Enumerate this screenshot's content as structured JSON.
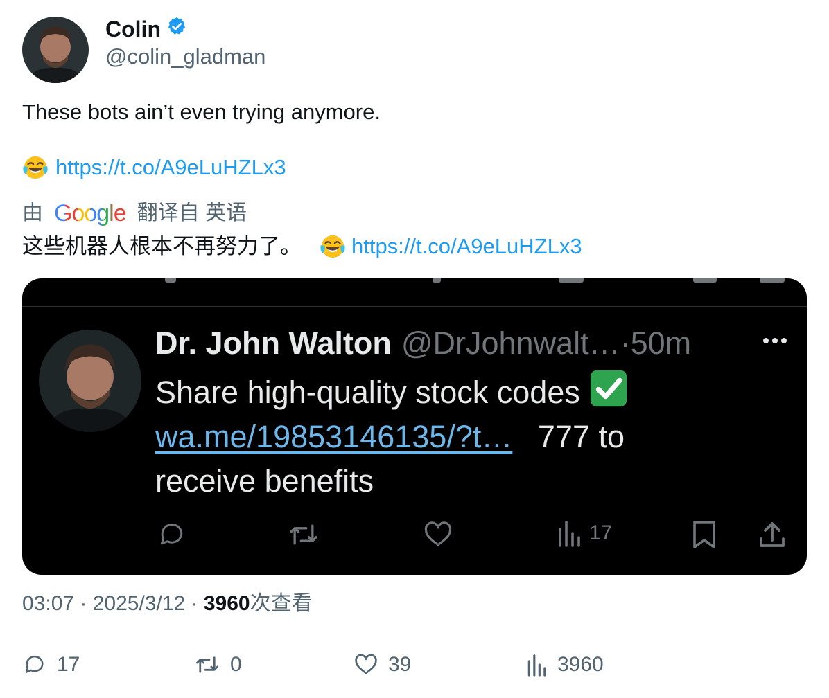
{
  "author": {
    "display_name": "Colin",
    "handle": "@colin_gladman",
    "verified": true
  },
  "tweet": {
    "text": "These bots ain’t even trying anymore.",
    "link": "https://t.co/A9eLuHZLx3",
    "emoji": "tears-of-joy"
  },
  "translation": {
    "prefix": "由",
    "provider": "Google",
    "suffix": "翻译自 英语",
    "text": "这些机器人根本不再努力了。",
    "link": "https://t.co/A9eLuHZLx3"
  },
  "embedded": {
    "name": "Dr. John Walton",
    "handle_time": "@DrJohnwalt…·50m",
    "line1": "Share high-quality stock codes",
    "link": "wa.me/19853146135/?t…",
    "after_link": "777 to",
    "line3": "receive benefits",
    "views": "17"
  },
  "meta": {
    "time_date": "03:07 · 2025/3/12 · ",
    "views_count": "3960",
    "views_label": "次查看"
  },
  "actions": {
    "replies": "17",
    "retweets": "0",
    "likes": "39",
    "views": "3960"
  },
  "colors": {
    "link": "#1d9bf0",
    "verified": "#1d9bf0",
    "secondary_text": "#536471"
  }
}
